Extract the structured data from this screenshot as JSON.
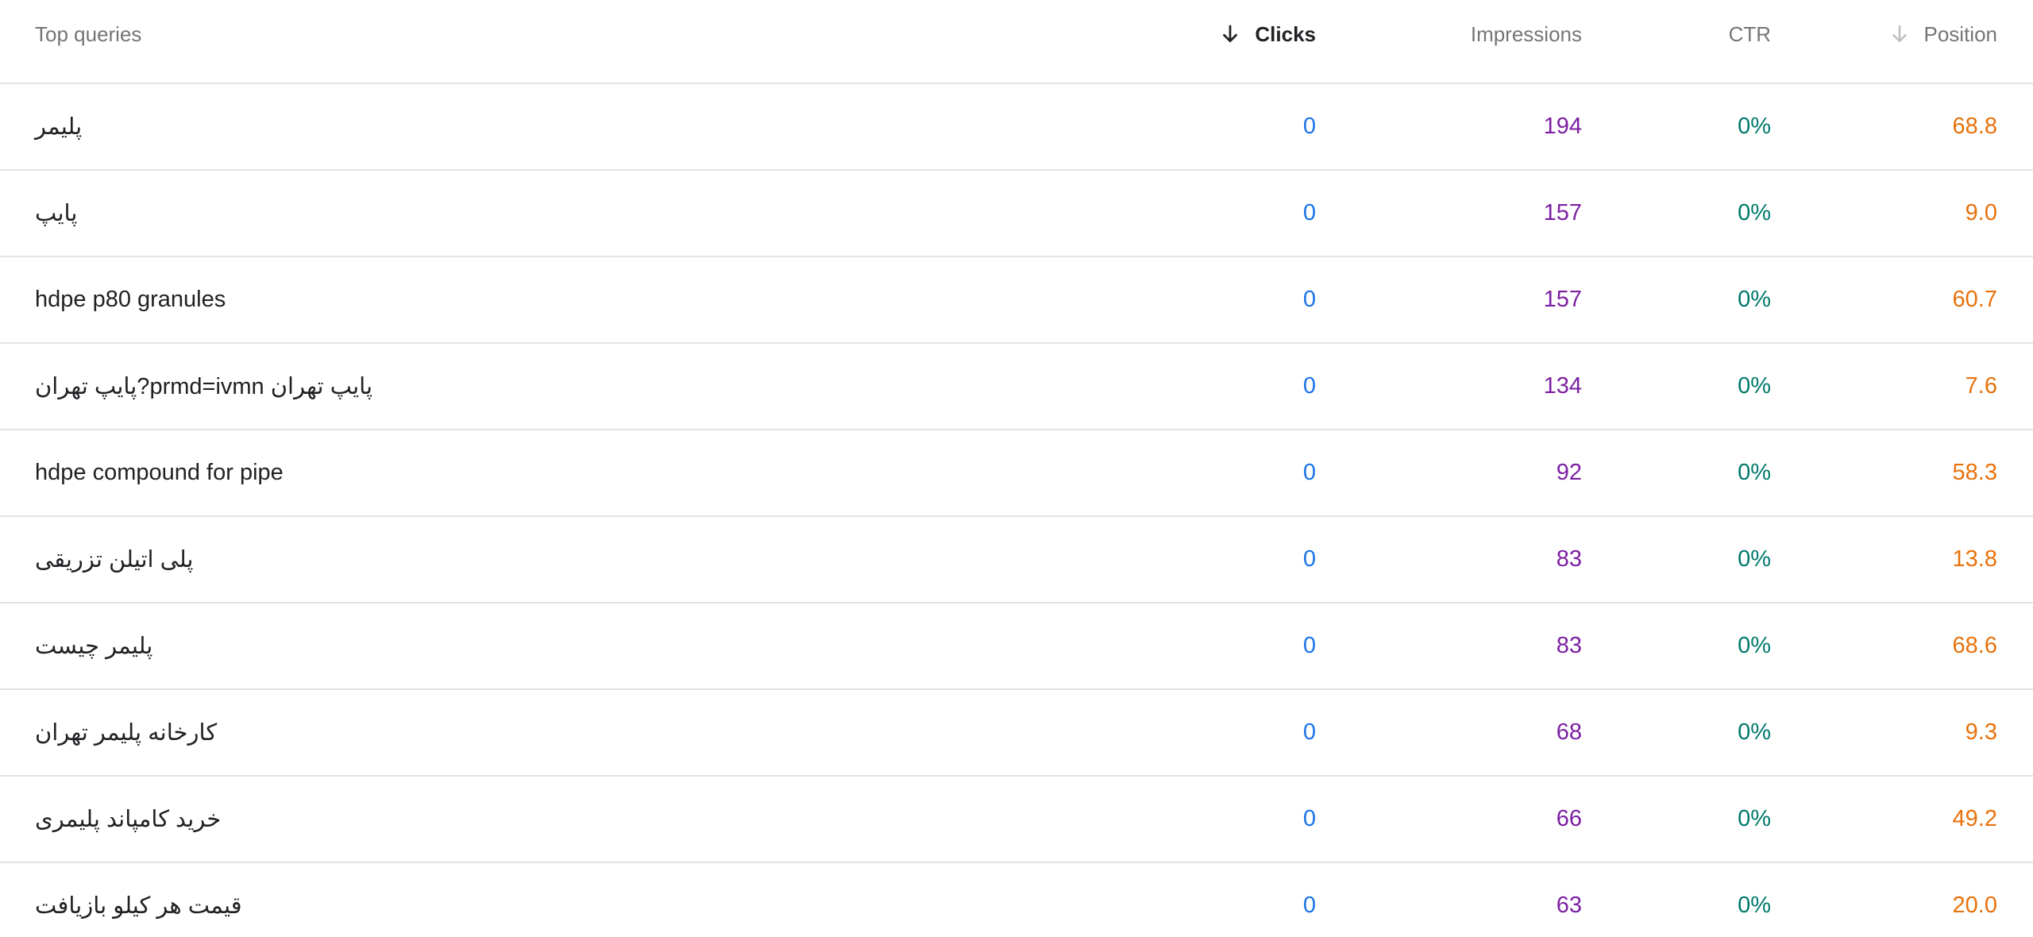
{
  "table": {
    "headers": {
      "query": "Top queries",
      "clicks": "Clicks",
      "impressions": "Impressions",
      "ctr": "CTR",
      "position": "Position"
    },
    "sort": {
      "clicks_icon": "arrow-down-icon",
      "position_icon": "arrow-down-icon"
    },
    "colors": {
      "clicks": "#1a73e8",
      "impressions": "#7b1fa2",
      "ctr": "#00796b",
      "position": "#e8710a",
      "text": "#202124",
      "header_text": "#757575",
      "divider": "#e3e3e3"
    },
    "rows": [
      {
        "query": "پلیمر",
        "clicks": "0",
        "impressions": "194",
        "ctr": "0%",
        "position": "68.8"
      },
      {
        "query": "پایپ",
        "clicks": "0",
        "impressions": "157",
        "ctr": "0%",
        "position": "9.0"
      },
      {
        "query": "hdpe p80 granules",
        "clicks": "0",
        "impressions": "157",
        "ctr": "0%",
        "position": "60.7"
      },
      {
        "query": "پایپ تهران prmd=ivmn?پایپ تهران",
        "clicks": "0",
        "impressions": "134",
        "ctr": "0%",
        "position": "7.6"
      },
      {
        "query": "hdpe compound for pipe",
        "clicks": "0",
        "impressions": "92",
        "ctr": "0%",
        "position": "58.3"
      },
      {
        "query": "پلی اتیلن تزریقی",
        "clicks": "0",
        "impressions": "83",
        "ctr": "0%",
        "position": "13.8"
      },
      {
        "query": "پلیمر چیست",
        "clicks": "0",
        "impressions": "83",
        "ctr": "0%",
        "position": "68.6"
      },
      {
        "query": "کارخانه پلیمر تهران",
        "clicks": "0",
        "impressions": "68",
        "ctr": "0%",
        "position": "9.3"
      },
      {
        "query": "خرید کامپاند پلیمری",
        "clicks": "0",
        "impressions": "66",
        "ctr": "0%",
        "position": "49.2"
      },
      {
        "query": "قیمت هر کیلو بازیافت",
        "clicks": "0",
        "impressions": "63",
        "ctr": "0%",
        "position": "20.0"
      }
    ]
  }
}
